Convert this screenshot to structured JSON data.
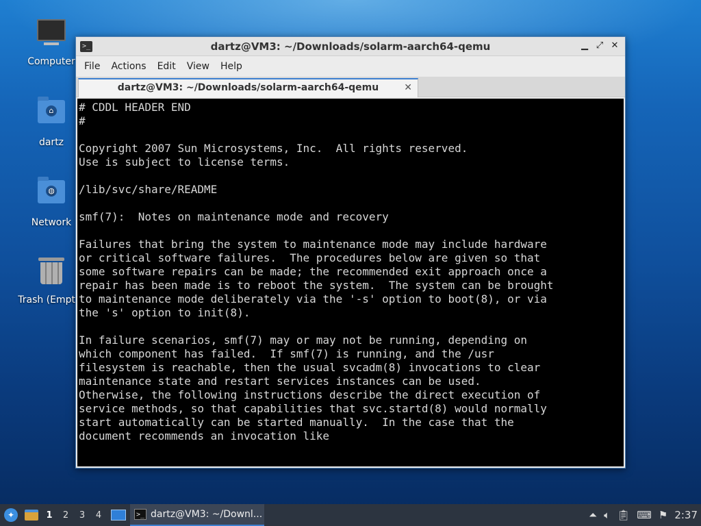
{
  "desktop": {
    "icons": [
      {
        "label": "Computer",
        "icon": "computer-icon"
      },
      {
        "label": "dartz",
        "icon": "home-folder-icon"
      },
      {
        "label": "Network",
        "icon": "network-folder-icon"
      },
      {
        "label": "Trash (Empty)",
        "icon": "trash-icon"
      }
    ]
  },
  "window": {
    "title": "dartz@VM3: ~/Downloads/solarm-aarch64-qemu",
    "controls": {
      "minimize": "▁",
      "maximize": "⤢",
      "close": "✕"
    },
    "menu": [
      "File",
      "Actions",
      "Edit",
      "View",
      "Help"
    ],
    "tab": {
      "label": "dartz@VM3: ~/Downloads/solarm-aarch64-qemu",
      "close": "✕"
    },
    "terminal_lines": [
      "# CDDL HEADER END",
      "#",
      "",
      "Copyright 2007 Sun Microsystems, Inc.  All rights reserved.",
      "Use is subject to license terms.",
      "",
      "/lib/svc/share/README",
      "",
      "smf(7):  Notes on maintenance mode and recovery",
      "",
      "Failures that bring the system to maintenance mode may include hardware",
      "or critical software failures.  The procedures below are given so that",
      "some software repairs can be made; the recommended exit approach once a",
      "repair has been made is to reboot the system.  The system can be brought",
      "to maintenance mode deliberately via the '-s' option to boot(8), or via",
      "the 's' option to init(8).",
      "",
      "In failure scenarios, smf(7) may or may not be running, depending on",
      "which component has failed.  If smf(7) is running, and the /usr",
      "filesystem is reachable, then the usual svcadm(8) invocations to clear",
      "maintenance state and restart services instances can be used.",
      "Otherwise, the following instructions describe the direct execution of",
      "service methods, so that capabilities that svc.startd(8) would normally",
      "start automatically can be started manually.  In the case that the",
      "document recommends an invocation like"
    ]
  },
  "taskbar": {
    "workspaces": [
      "1",
      "2",
      "3",
      "4"
    ],
    "active_workspace": "1",
    "task_label": "dartz@VM3: ~/Downl...",
    "tray_icons": [
      "network-up-icon",
      "volume-icon",
      "clipboard-icon",
      "keyboard-icon",
      "update-icon"
    ],
    "clock": "2:37"
  }
}
